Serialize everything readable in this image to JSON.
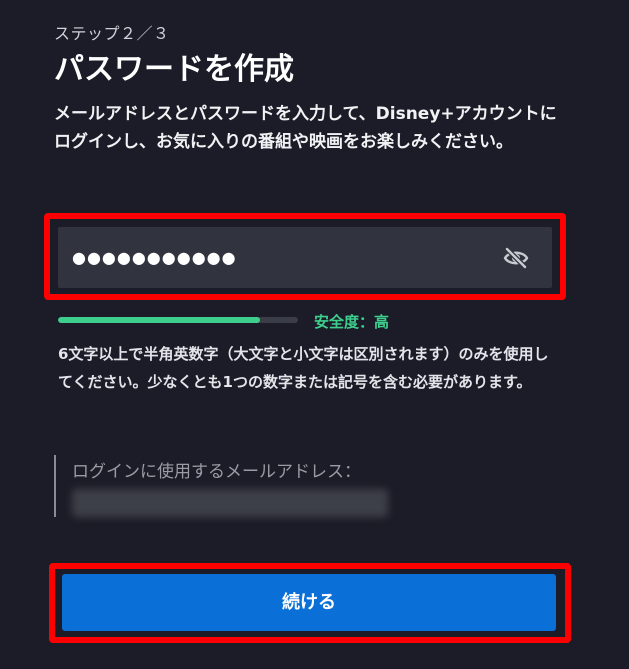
{
  "step": {
    "label": "ステップ２／３"
  },
  "title": "パスワードを作成",
  "description": "メールアドレスとパスワードを入力して、Disney+アカウントにログインし、お気に入りの番組や映画をお楽しみください。",
  "password_field": {
    "value": "●●●●●●●●●●●",
    "toggle_icon": "eye-off-icon"
  },
  "strength": {
    "label": "安全度：高",
    "level": 0.84,
    "color": "#3ecf8e"
  },
  "hint": "6文字以上で半角英数字（大文字と小文字は区別されます）のみを使用してください。少なくとも1つの数字または記号を含む必要があります。",
  "email": {
    "label": "ログインに使用するメールアドレス："
  },
  "continue_button": {
    "label": "続ける",
    "color": "#0a6fd6"
  },
  "highlight_color": "#ff0000"
}
